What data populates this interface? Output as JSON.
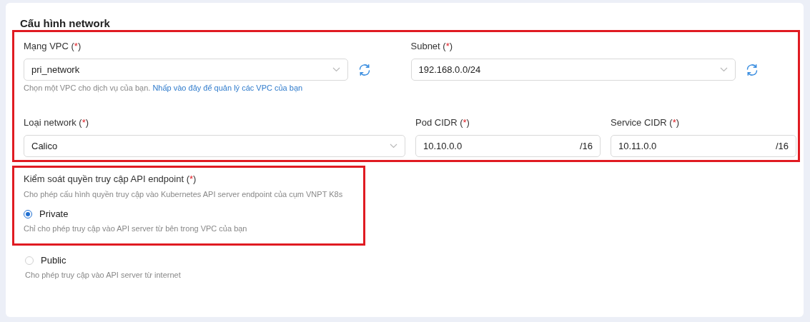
{
  "section_title": "Cấu hình network",
  "network": {
    "highlighted": true,
    "rows": [
      [
        {
          "kind": "select",
          "label": "Mạng VPC (",
          "required_mark": "*",
          "label_close": ")",
          "value": "pri_network",
          "refresh": true,
          "hint": "Chọn một VPC cho dịch vụ của bạn.",
          "hint_link": "Nhấp vào đây để quản lý các VPC của bạn"
        },
        {
          "kind": "select",
          "label": "Subnet (",
          "required_mark": "*",
          "label_close": ")",
          "value": "192.168.0.0/24",
          "refresh": true
        }
      ],
      [
        {
          "kind": "select",
          "label": "Loại network (",
          "required_mark": "*",
          "label_close": ")",
          "value": "Calico",
          "refresh": false
        },
        {
          "kind": "cidr",
          "label": "Pod CIDR (",
          "required_mark": "*",
          "label_close": ")",
          "value": "10.10.0.0",
          "suffix": "/16"
        },
        {
          "kind": "cidr",
          "label": "Service CIDR (",
          "required_mark": "*",
          "label_close": ")",
          "value": "10.11.0.0",
          "suffix": "/16"
        }
      ]
    ]
  },
  "access": {
    "highlighted": true,
    "title": "Kiểm soát quyền truy cập API endpoint (",
    "required_mark": "*",
    "title_close": ")",
    "description": "Cho phép cấu hình quyền truy cập vào Kubernetes API server endpoint của cụm VNPT K8s",
    "options": [
      {
        "label": "Private",
        "description": "Chỉ cho phép truy cập vào API server từ bên trong VPC của bạn",
        "selected": true,
        "highlighted": true
      },
      {
        "label": "Public",
        "description": "Cho phép truy cập vào API server từ internet",
        "selected": false,
        "highlighted": false
      }
    ]
  }
}
